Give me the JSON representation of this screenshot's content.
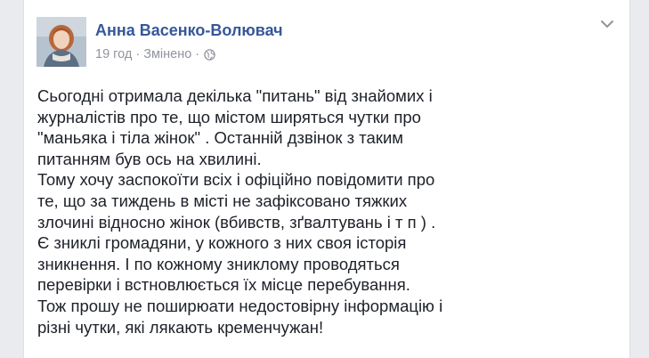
{
  "post": {
    "author": "Анна Васенко-Волювач",
    "time": "19 год",
    "separator_1": "·",
    "edited": "Змінено",
    "separator_2": "·",
    "privacy_icon": "globe-icon",
    "menu_icon": "chevron-down-icon",
    "paragraphs": [
      "Сьогодні отримала декілька \"питань\" від знайомих і журналістів про те, що містом ширяться чутки про \"маньяка і тіла жінок\" . Останній дзвінок з таким питанням був ось на хвилині.",
      "Тому хочу заспокоїти всіх і офіційно повідомити про те, що за тиждень в місті не зафіксовано тяжких злочині відносно жінок (вбивств, зґвалтувань і т п ) .",
      "Є зниклі громадяни, у кожного з них своя історія зникнення. І по кожному зниклому проводяться перевірки і встновлюється їх місце перебування.",
      "Тож прошу не поширюати недостовірну інформацію і різні чутки, які лякають кременчужан!"
    ]
  },
  "colors": {
    "name_blue": "#365899",
    "meta_gray": "#90949c",
    "text": "#1d2129",
    "page_bg": "#e9ebee"
  }
}
